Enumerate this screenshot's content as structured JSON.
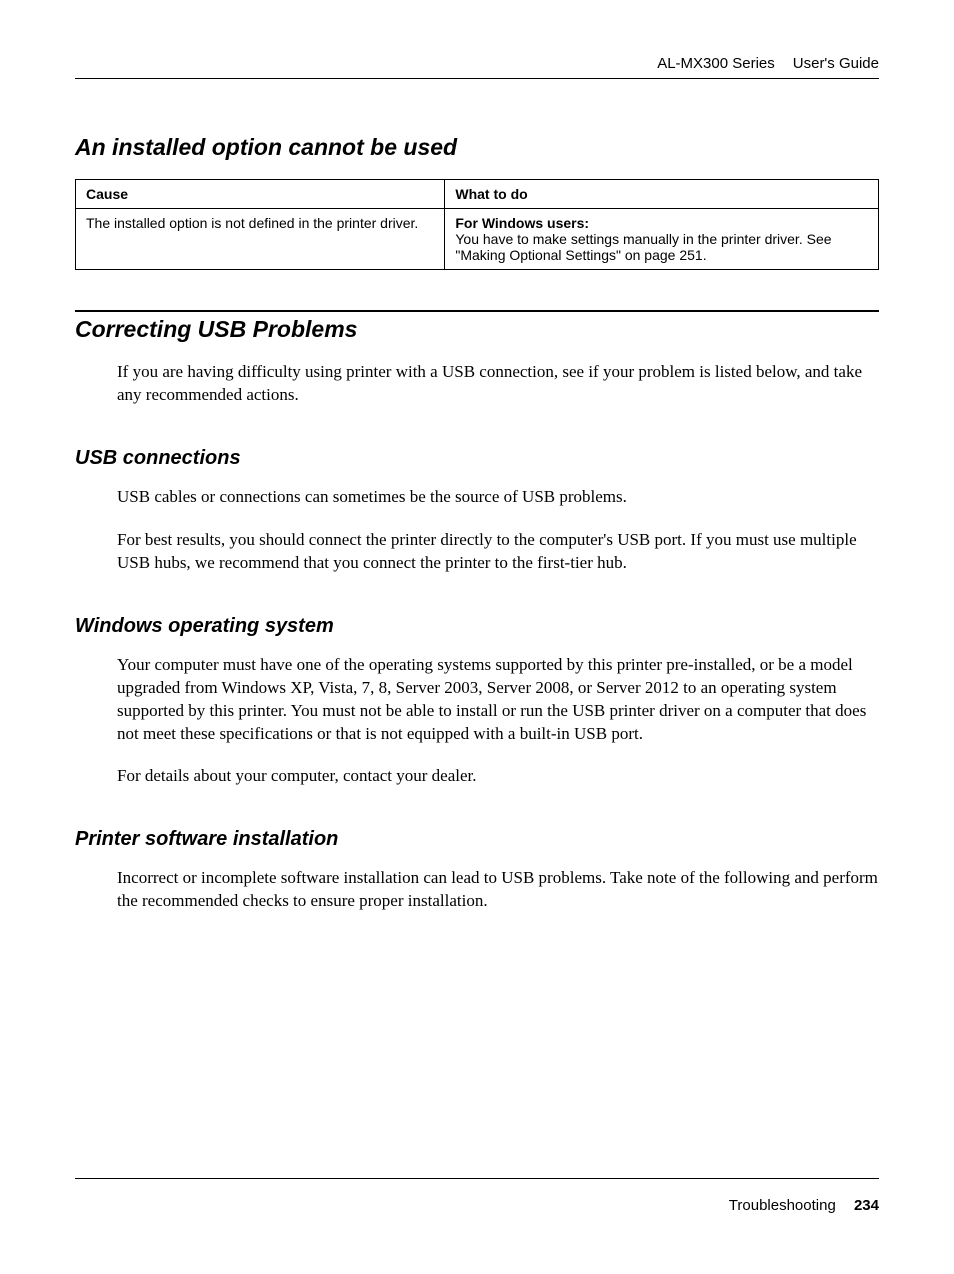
{
  "header": {
    "series": "AL-MX300 Series",
    "doc_type": "User's Guide"
  },
  "sections": {
    "installed_option": {
      "title": "An installed option cannot be used",
      "table": {
        "head": {
          "cause": "Cause",
          "todo": "What to do"
        },
        "row": {
          "cause": "The installed option is not defined in the printer driver.",
          "todo_bold": "For Windows users:",
          "todo_rest": "You have to make settings manually in the printer driver. See \"Making Optional Settings\" on page 251."
        }
      }
    },
    "usb": {
      "title": "Correcting USB Problems",
      "intro": "If you are having difficulty using printer with a USB connection, see if your problem is listed below, and take any recommended actions."
    },
    "usb_conn": {
      "title": "USB connections",
      "p1": "USB cables or connections can sometimes be the source of USB problems.",
      "p2": "For best results, you should connect the printer directly to the computer's USB port. If you must use multiple USB hubs, we recommend that you connect the printer to the first-tier hub."
    },
    "win_os": {
      "title": "Windows operating system",
      "p1": "Your computer must have one of the operating systems supported by this printer pre-installed, or be a model upgraded from Windows XP, Vista, 7, 8, Server 2003, Server 2008, or Server 2012 to an operating system supported by this printer. You must not be able to install or run the USB printer driver on a computer that does not meet these specifications or that is not equipped with a built-in USB port.",
      "p2": "For details about your computer, contact your dealer."
    },
    "sw_install": {
      "title": "Printer software installation",
      "p1": "Incorrect or incomplete software installation can lead to USB problems. Take note of the following and perform the recommended checks to ensure proper installation."
    }
  },
  "footer": {
    "section": "Troubleshooting",
    "page": "234"
  }
}
